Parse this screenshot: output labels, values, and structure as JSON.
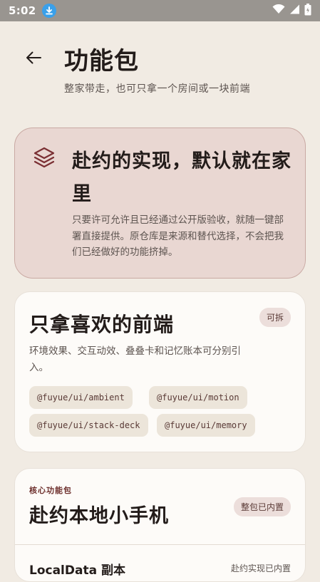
{
  "status_bar": {
    "time": "5:02",
    "icons": [
      "download-icon",
      "wifi-icon",
      "signal-icon",
      "battery-icon"
    ]
  },
  "header": {
    "back_icon": "arrow-left-icon",
    "title": "功能包",
    "subtitle": "整家带走，也可只拿一个房间或一块前端"
  },
  "hero": {
    "icon": "layers-icon",
    "title": "赴约的实现，默认就在家里",
    "description": "只要许可允许且已经通过公开版验收，就随一键部署直接提供。原仓库是来源和替代选择，不会把我们已经做好的功能挤掉。"
  },
  "frontend_card": {
    "title": "只拿喜欢的前端",
    "badge": "可拆",
    "description": "环境效果、交互动效、叠叠卡和记忆账本可分别引入。",
    "packages": [
      "@fuyue/ui/ambient",
      "@fuyue/ui/motion",
      "@fuyue/ui/stack-deck",
      "@fuyue/ui/memory"
    ]
  },
  "core_card": {
    "eyebrow": "核心功能包",
    "title": "赴约本地小手机",
    "badge": "整包已内置",
    "row": {
      "title": "LocalData 副本",
      "meta": "赴约实现已内置"
    }
  },
  "colors": {
    "background": "#f1ebe3",
    "hero_bg": "#e9d7d2",
    "accent": "#7a2f33",
    "card_bg": "#fdfbf8",
    "chip_bg": "#ece5da"
  }
}
